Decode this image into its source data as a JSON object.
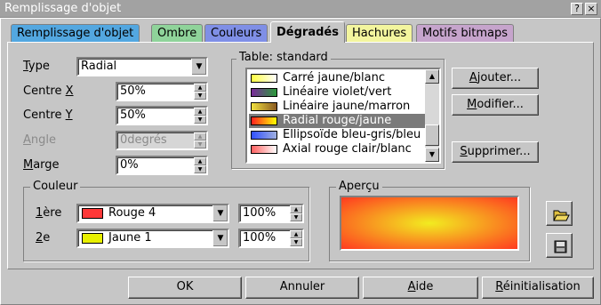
{
  "window": {
    "title": "Remplissage d'objet",
    "btn_help": "?",
    "btn_close": "×"
  },
  "tabs": [
    {
      "label": "Remplissage d'objet",
      "color": "#53a7e0"
    },
    {
      "label": "Ombre",
      "color": "#8fd39a"
    },
    {
      "label": "Couleurs",
      "color": "#7f8fe6"
    },
    {
      "label": "Dégradés",
      "color": "#c6c6c6"
    },
    {
      "label": "Hachures",
      "color": "#f3f59e"
    },
    {
      "label": "Motifs bitmaps",
      "color": "#c6a4cc"
    }
  ],
  "form": {
    "type": {
      "label_prefix": "T",
      "label_rest": "ype",
      "value": "Radial"
    },
    "center_x": {
      "label_prefix": "Centre ",
      "label_mn": "X",
      "value": "50%"
    },
    "center_y": {
      "label_prefix": "Centre ",
      "label_mn": "Y",
      "value": "50%"
    },
    "angle": {
      "label_mn": "A",
      "label_rest": "ngle",
      "value": "0degrés"
    },
    "margin": {
      "label_mn": "M",
      "label_rest": "arge",
      "value": "0%"
    }
  },
  "table": {
    "group_label": "Table: standard",
    "items": [
      {
        "label": "Carré jaune/blanc",
        "c1": "#ffff40",
        "c2": "#ffffff"
      },
      {
        "label": "Linéaire violet/vert",
        "c1": "#7a2a9a",
        "c2": "#2a9a3a"
      },
      {
        "label": "Linéaire jaune/marron",
        "c1": "#f0e040",
        "c2": "#8a5a20"
      },
      {
        "label": "Radial rouge/jaune",
        "c1": "#ff2020",
        "c2": "#ffff00"
      },
      {
        "label": "Ellipsoïde bleu-gris/bleu",
        "c1": "#3050ff",
        "c2": "#a0b0e0"
      },
      {
        "label": "Axial rouge clair/blanc",
        "c1": "#ff6060",
        "c2": "#ffffff"
      }
    ],
    "selected_index": 3
  },
  "buttons": {
    "add": {
      "mn": "A",
      "rest": "jouter..."
    },
    "modify": {
      "mn": "M",
      "rest": "odifier..."
    },
    "delete": {
      "mn": "S",
      "rest": "upprimer..."
    }
  },
  "colors": {
    "group_label": "Couleur",
    "first": {
      "label_mn": "1",
      "label_rest": "ère",
      "swatch": "#ff3838",
      "name": "Rouge 4",
      "intensity": "100%"
    },
    "second": {
      "label_mn": "2",
      "label_rest": "e",
      "swatch": "#e8f000",
      "name": "Jaune 1",
      "intensity": "100%"
    }
  },
  "preview": {
    "group_label": "Aperçu",
    "inner": "#f2ec20",
    "outer": "#ff3a20"
  },
  "footer": {
    "ok": "OK",
    "cancel": "Annuler",
    "help": {
      "mn": "A",
      "rest": "ide"
    },
    "reset": {
      "mn": "R",
      "rest": "éinitialisation"
    }
  }
}
